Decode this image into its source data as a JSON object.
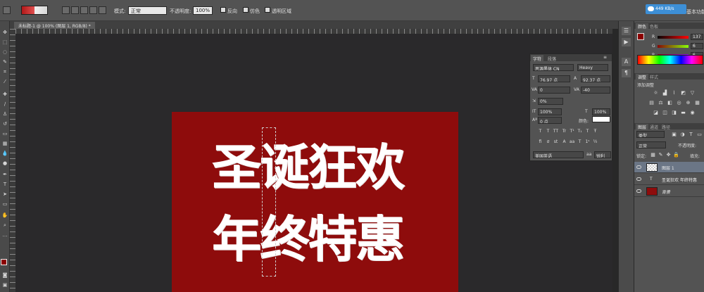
{
  "options_bar": {
    "mode_label": "模式:",
    "mode_value": "正常",
    "opacity_label": "不透明度:",
    "opacity_value": "100%",
    "reverse_label": "反向",
    "dither_label": "仿色",
    "transparency_label": "透明区域"
  },
  "cloud": {
    "text": "449 KB/s"
  },
  "workspace": {
    "label": "基本功能"
  },
  "document": {
    "tab_label": "未标题-1 @ 100% (图层 1, RGB/8) *"
  },
  "character_panel": {
    "tab_character": "字符",
    "tab_paragraph": "段落",
    "font_family": "思源黑体 CN",
    "font_style": "Heavy",
    "font_size": "76.97 点",
    "leading": "92.37 点",
    "kerning": "0",
    "tracking": "-40",
    "scale_percent": "0%",
    "vertical_scale": "100%",
    "horizontal_scale": "100%",
    "baseline_shift": "0 点",
    "color_label": "颜色:",
    "language": "美国英语",
    "antialias": "锐利",
    "color": "#ffffff"
  },
  "color_panel": {
    "tab_color": "颜色",
    "tab_swatches": "色板",
    "r_label": "R",
    "g_label": "G",
    "b_label": "B",
    "r_value": "137",
    "g_value": "6",
    "b_value": "6",
    "foreground": "#8b0000"
  },
  "adjustments_panel": {
    "tab_adjust": "调整",
    "tab_styles": "样式",
    "add_label": "添加调整"
  },
  "layers_panel": {
    "tab_layers": "图层",
    "tab_channels": "通道",
    "tab_paths": "路径",
    "filter_label": "类型",
    "blend_mode": "正常",
    "opacity_label": "不透明度:",
    "lock_label": "锁定:",
    "fill_label": "填充:",
    "layers": [
      {
        "name": "图层 1"
      },
      {
        "name": "圣诞狂欢 年终特惠"
      },
      {
        "name": "背景"
      }
    ]
  },
  "canvas": {
    "line1": "圣诞狂欢",
    "line2": "年终特惠",
    "background_color": "#8e0c0c"
  }
}
